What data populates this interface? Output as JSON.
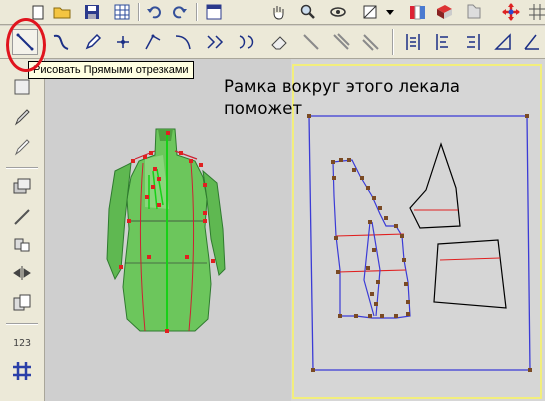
{
  "tooltip": {
    "text": "Рисовать Прямыми отрезками"
  },
  "annotation": {
    "line1": "Рамка вокруг этого лекала",
    "line2": "поможет"
  },
  "left_toolbar": {
    "counter_label": "123"
  },
  "colors": {
    "highlight_circle": "#e0141e",
    "pattern_frame": "#3b3bd6",
    "selection_border": "#f2ee7c",
    "mannequin": "#6cc65c",
    "seam_line": "#e02020"
  },
  "toolbar_top": {
    "icons": [
      "new-document-icon",
      "open-folder-icon",
      "save-icon",
      "pattern-grid-icon",
      "undo-icon",
      "redo-icon",
      "window-icon",
      "hand-pan-icon",
      "zoom-icon",
      "rotate-icon",
      "dropdown-arrow-icon",
      "fabric-icon",
      "book-icon",
      "flag-icon",
      "move-cross-icon",
      "grid-icon"
    ]
  },
  "toolbar_draw": {
    "icons": [
      "draw-straight-segments-icon",
      "draw-curve-icon",
      "pencil-icon",
      "point-icon",
      "spline-icon",
      "arc-icon",
      "bezier-icon",
      "bezier-alt-icon",
      "eraser-icon",
      "line-arrow-icon",
      "parallel-line-icon",
      "diagonal-line-icon",
      "align-vertical-icon",
      "align-left-icon",
      "align-right-icon",
      "triangle-icon",
      "angle-icon"
    ]
  },
  "left_tools": {
    "icons": [
      "select-icon",
      "pen-icon",
      "pencil-icon",
      "layers-icon",
      "line-icon",
      "mirror-icon",
      "flip-icon",
      "copy-icon",
      "counter-icon",
      "grid-hash-icon"
    ]
  }
}
